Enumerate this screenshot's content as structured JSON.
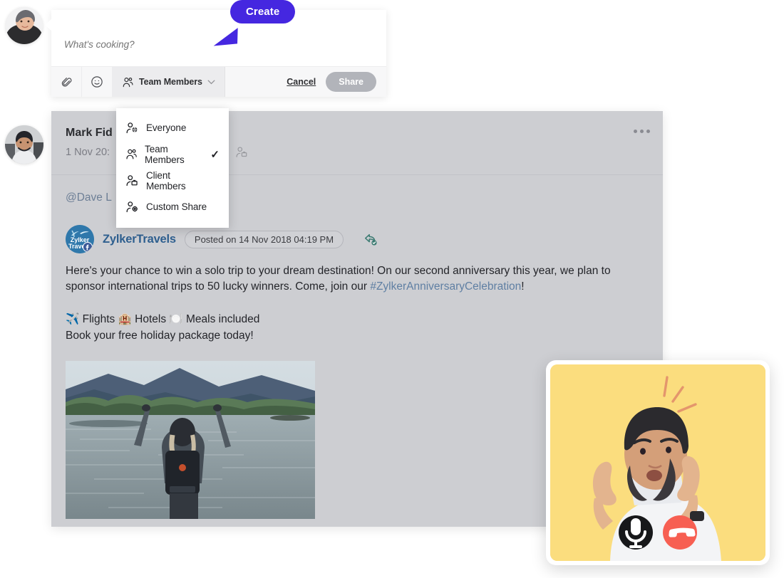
{
  "composer": {
    "placeholder": "What's cooking?",
    "value": "",
    "attach_icon": "paperclip-icon",
    "emoji_icon": "smiley-icon",
    "scope_label": "Team Members",
    "scope_icon": "team-members-icon",
    "chevron_icon": "chevron-down-icon",
    "cancel_label": "Cancel",
    "share_label": "Share"
  },
  "tooltip": {
    "label": "Create",
    "color": "#4527E0"
  },
  "scope_menu": {
    "items": [
      {
        "label": "Everyone",
        "icon": "person-globe-icon",
        "checked": ""
      },
      {
        "label": "Team Members",
        "icon": "team-members-icon",
        "checked": "✓"
      },
      {
        "label": "Client Members",
        "icon": "person-briefcase-icon",
        "checked": ""
      },
      {
        "label": "Custom Share",
        "icon": "person-gear-icon",
        "checked": ""
      }
    ]
  },
  "post": {
    "author": "Mark Fid",
    "date": "1 Nov 20:",
    "scope_icon": "client-members-icon",
    "more_icon": "more-options-icon",
    "mention": "@Dave L"
  },
  "shared_item": {
    "brand": "ZylkerTravels",
    "brand_logo_text_1": "Zylker",
    "brand_logo_text_2": "Travel",
    "source_badge": "facebook-badge",
    "posted_on": "Posted on 14 Nov 2018 04:19 PM",
    "share_icon": "shared-post-icon",
    "body_part1": "Here's your chance to win a solo trip to your dream destination! On our second anniversary this year, we plan to sponsor international trips to 50 lucky winners. Come, join our ",
    "hashtag": "#ZylkerAnniversaryCelebration",
    "body_part2": "!",
    "perks_line": "✈️ Flights 🏨 Hotels 🍽️ Meals included",
    "cta_line": "Book your free holiday package today!",
    "photo_alt": "lake-landscape-photo"
  },
  "video_call": {
    "background_color": "#FBDD7E",
    "participant_alt": "video-participant",
    "mic_icon": "microphone-icon",
    "hangup_icon": "hangup-phone-icon",
    "mic_color": "#17181A",
    "hangup_color": "#F75F52"
  },
  "avatars": {
    "top_alt": "user-avatar-top",
    "bottom_alt": "user-avatar-bottom"
  }
}
